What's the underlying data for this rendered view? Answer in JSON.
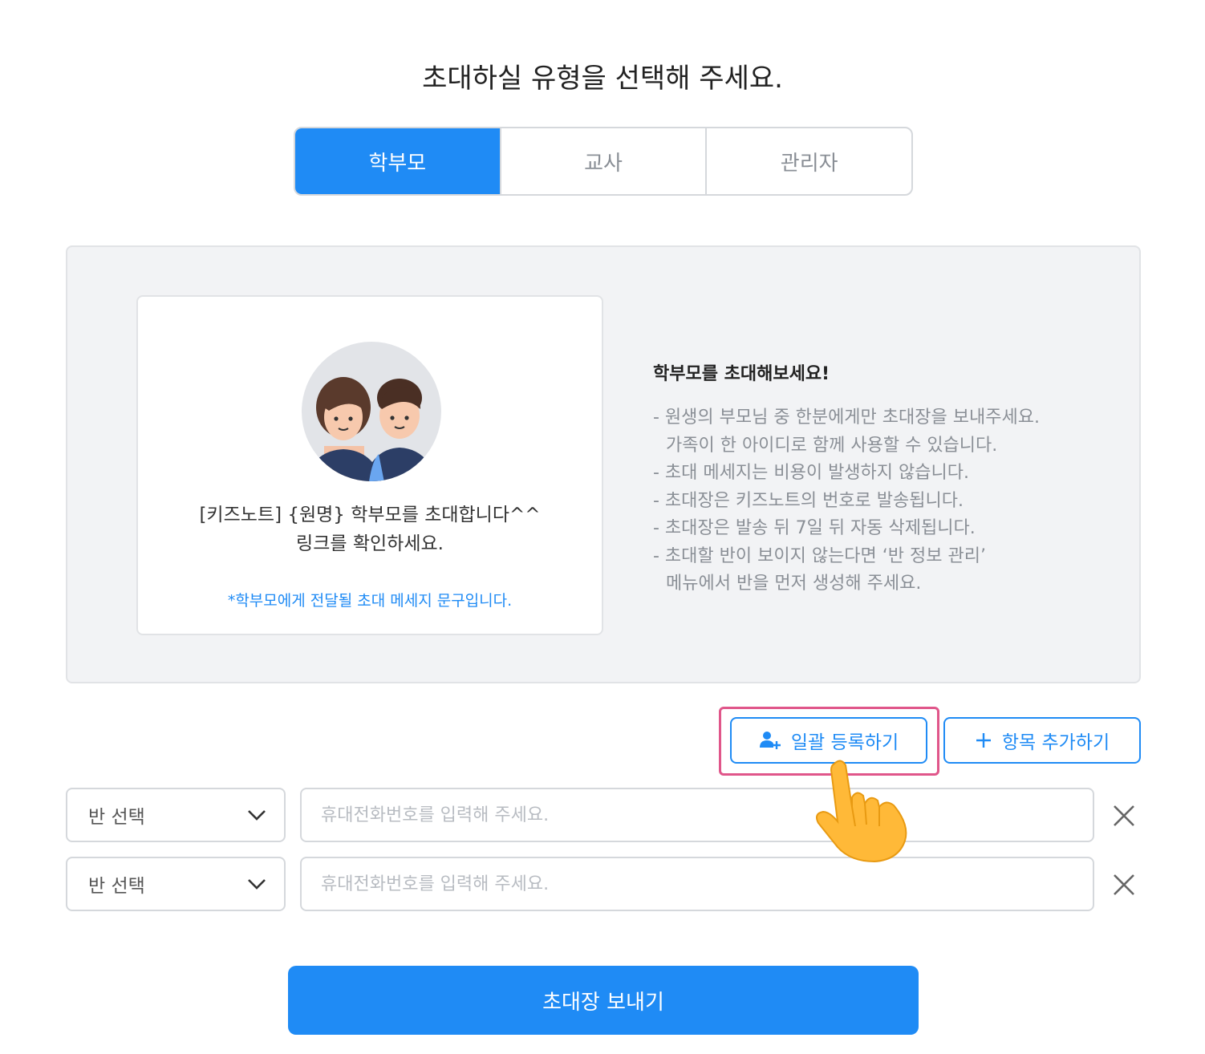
{
  "page": {
    "title": "초대하실 유형을 선택해 주세요."
  },
  "tabs": [
    {
      "label": "학부모",
      "active": true
    },
    {
      "label": "교사",
      "active": false
    },
    {
      "label": "관리자",
      "active": false
    }
  ],
  "message_card": {
    "avatar_icon": "parents-avatar-icon",
    "line1": "[키즈노트] {원명} 학부모를 초대합니다^^",
    "line2": "링크를 확인하세요.",
    "note": "*학부모에게 전달될 초대 메세지 문구입니다."
  },
  "guide": {
    "title": "학부모를 초대해보세요!",
    "items": [
      "- 원생의 부모님 중 한분에게만 초대장을 보내주세요.",
      "  가족이 한 아이디로 함께 사용할 수 있습니다.",
      "- 초대 메세지는 비용이 발생하지 않습니다.",
      "- 초대장은 키즈노트의 번호로 발송됩니다.",
      "- 초대장은 발송 뒤 7일 뒤 자동 삭제됩니다.",
      "- 초대할 반이 보이지 않는다면 ‘반 정보 관리’",
      "  메뉴에서 반을 먼저 생성해 주세요."
    ]
  },
  "actions": {
    "bulk_label": "일괄 등록하기",
    "bulk_icon": "user-add-icon",
    "add_label": "항목 추가하기",
    "add_icon": "plus-icon"
  },
  "rows": [
    {
      "class_select": "반 선택",
      "phone_value": "",
      "phone_placeholder": "휴대전화번호를 입력해 주세요."
    },
    {
      "class_select": "반 선택",
      "phone_value": "",
      "phone_placeholder": "휴대전화번호를 입력해 주세요."
    }
  ],
  "submit_label": "초대장 보내기",
  "colors": {
    "accent": "#1f8bf5",
    "highlight": "#e0568a",
    "panel_bg": "#f2f3f5"
  }
}
